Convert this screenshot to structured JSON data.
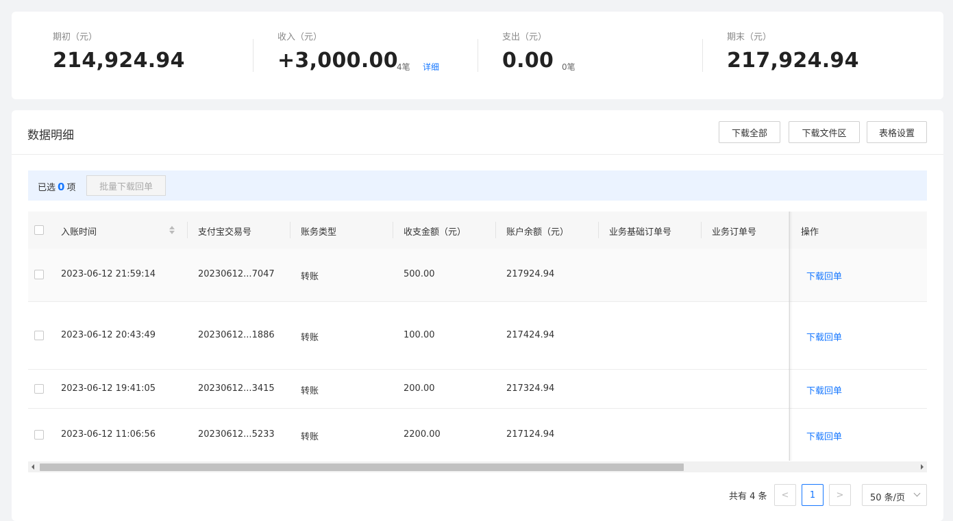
{
  "summary": {
    "opening": {
      "label": "期初（元）",
      "value": "214,924.94"
    },
    "income": {
      "label": "收入（元）",
      "value": "+3,000.00",
      "count": "4笔",
      "detail": "详细"
    },
    "expense": {
      "label": "支出（元）",
      "value": "0.00",
      "count": "0笔"
    },
    "closing": {
      "label": "期末（元）",
      "value": "217,924.94"
    }
  },
  "detail": {
    "title": "数据明细",
    "buttons": {
      "download_all": "下载全部",
      "download_files": "下载文件区",
      "table_settings": "表格设置"
    },
    "selection": {
      "prefix": "已选",
      "count": "0",
      "suffix": "项",
      "batch_button": "批量下载回单"
    }
  },
  "table": {
    "columns": [
      "入账时间",
      "支付宝交易号",
      "账务类型",
      "收支金额（元）",
      "账户余额（元）",
      "业务基础订单号",
      "业务订单号",
      "操作"
    ],
    "rows": [
      {
        "time": "2023-06-12 21:59:14",
        "trade_no": "20230612...7047",
        "type": "转账",
        "amount": "500.00",
        "balance": "217924.94",
        "action": "下载回单"
      },
      {
        "time": "2023-06-12 20:43:49",
        "trade_no": "20230612...1886",
        "type": "转账",
        "amount": "100.00",
        "balance": "217424.94",
        "action": "下载回单"
      },
      {
        "time": "2023-06-12 19:41:05",
        "trade_no": "20230612...3415",
        "type": "转账",
        "amount": "200.00",
        "balance": "217324.94",
        "action": "下载回单"
      },
      {
        "time": "2023-06-12 11:06:56",
        "trade_no": "20230612...5233",
        "type": "转账",
        "amount": "2200.00",
        "balance": "217124.94",
        "action": "下载回单"
      }
    ]
  },
  "pagination": {
    "total": "共有 4 条",
    "current_page": "1",
    "page_size": "50 条/页",
    "prev": "<",
    "next": ">"
  },
  "colors": {
    "accent": "#1677ff",
    "selection_bg": "#ebf3ff"
  }
}
